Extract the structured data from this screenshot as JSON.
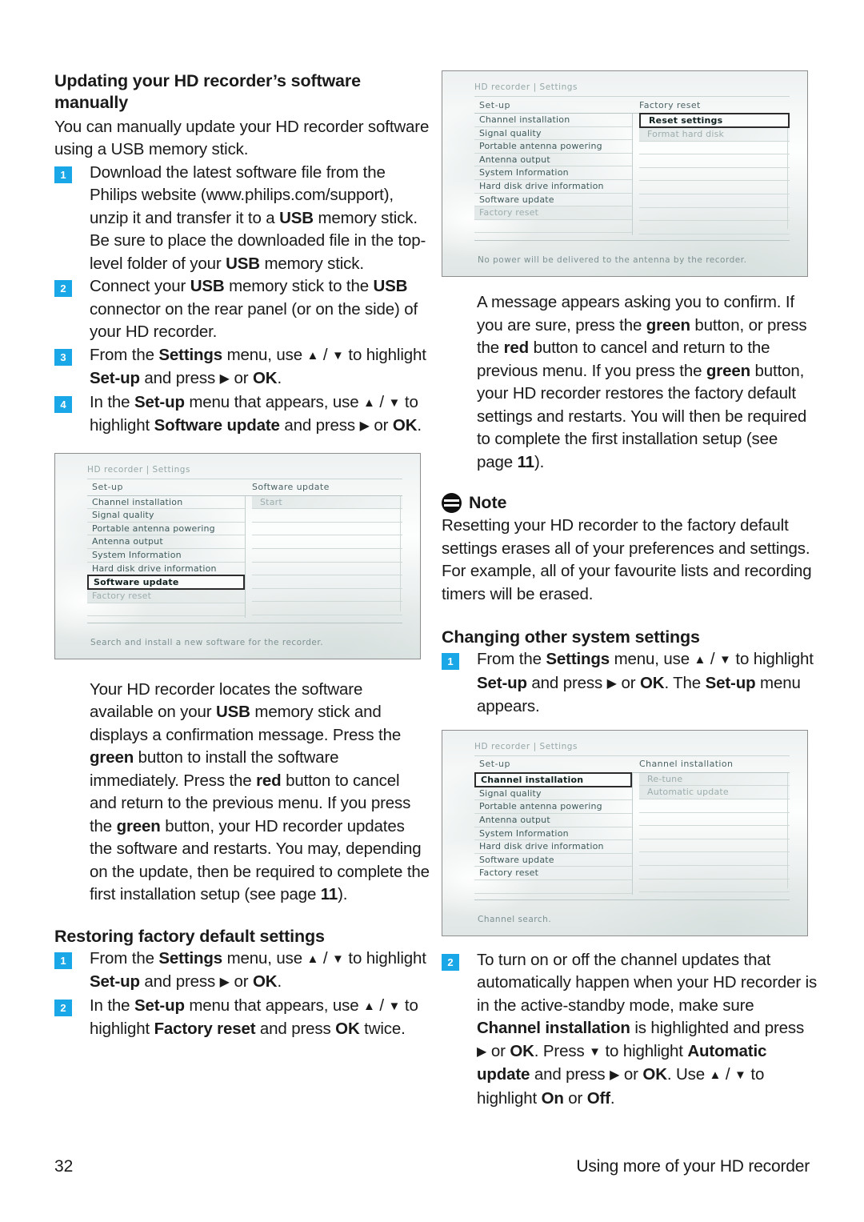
{
  "document": {
    "page_number": "32",
    "footer_title": "Using more of your HD recorder"
  },
  "left_column": {
    "heading": "Updating your HD recorder’s software manually",
    "intro": "You can manually update your HD recorder software using a USB memory stick.",
    "steps": [
      {
        "num": "1",
        "text": "Download the latest software file from the Philips website (www.philips.com/support), unzip it and transfer it to a USB memory stick. Be sure to place the downloaded file in the top-level folder of your USB memory stick."
      },
      {
        "num": "2",
        "text": "Connect your USB memory stick to the USB connector on the rear panel (or on the side) of your HD recorder."
      },
      {
        "num": "3",
        "text": "From the Settings menu, use ▲ / ▼ to highlight Set-up and press ▶ or OK."
      },
      {
        "num": "4",
        "text": "In the Set-up menu that appears, use ▲ / ▼ to highlight Software update and press ▶ or OK."
      }
    ],
    "after_image_paragraph": "Your HD recorder locates the software available on your USB memory stick and displays a confirmation message. Press the green button to install the software immediately. Press the red button to cancel and return to the previous menu. If you press the green button, your HD recorder updates the software and restarts. You may, depending on the update, then be required to complete the first installation setup (see page 11).",
    "restore_heading": "Restoring factory default settings",
    "restore_steps": [
      {
        "num": "1",
        "text": "From the Settings menu, use ▲ / ▼ to highlight Set-up and press ▶ or OK."
      },
      {
        "num": "2",
        "text": "In the Set-up menu that appears, use ▲ / ▼ to highlight Factory reset and press OK twice."
      }
    ]
  },
  "right_column": {
    "confirm_paragraph": "A message appears asking you to confirm. If you are sure, press the green button, or press the red button to cancel and return to the previous menu. If you press the green button, your HD recorder restores the factory default settings and restarts. You will then be required to complete the first installation setup (see page 11).",
    "note": {
      "icon": "note-icon",
      "title": "Note",
      "text": "Resetting your HD recorder to the factory default settings erases all of your preferences and settings. For example, all of your favourite lists and recording timers will be erased."
    },
    "changing_heading": "Changing other system settings",
    "changing_steps": [
      {
        "num": "1",
        "text": "From the Settings menu, use ▲ / ▼ to highlight Set-up and press ▶ or OK. The Set-up menu appears."
      },
      {
        "num": "2",
        "text": "To turn on or off the channel updates that automatically happen when your HD recorder is in the active-standby mode, make sure Channel installation is highlighted and press ▶ or OK. Press ▼ to highlight Automatic update and press ▶ or OK. Use ▲ / ▼ to highlight On or Off."
      }
    ]
  },
  "osd_screens": {
    "factory_reset": {
      "breadcrumb": "HD recorder | Settings",
      "col1_header": "Set-up",
      "col2_header": "Factory reset",
      "left_items": [
        "Channel installation",
        "Signal quality",
        "Portable antenna powering",
        "Antenna output",
        "System Information",
        "Hard disk drive information",
        "Software update",
        "Factory reset"
      ],
      "left_selected_index": 7,
      "left_selected_style": "dim",
      "right_items": [
        "Reset settings",
        "Format hard disk"
      ],
      "right_selected_index": 0,
      "status": "No power will be delivered to the antenna by the recorder."
    },
    "software_update": {
      "breadcrumb": "HD recorder | Settings",
      "col1_header": "Set-up",
      "col2_header": "Software update",
      "left_items": [
        "Channel installation",
        "Signal quality",
        "Portable antenna powering",
        "Antenna output",
        "System Information",
        "Hard disk drive information",
        "Software update",
        "Factory reset"
      ],
      "left_selected_index": 6,
      "left_selected_style": "box",
      "right_items": [
        "Start"
      ],
      "right_selected_index": -1,
      "status": "Search and install a new software for the recorder."
    },
    "channel_installation": {
      "breadcrumb": "HD recorder | Settings",
      "col1_header": "Set-up",
      "col2_header": "Channel installation",
      "left_items": [
        "Channel installation",
        "Signal quality",
        "Portable antenna powering",
        "Antenna output",
        "System Information",
        "Hard disk drive information",
        "Software update",
        "Factory reset"
      ],
      "left_selected_index": 0,
      "left_selected_style": "box",
      "right_items": [
        "Re-tune",
        "Automatic update"
      ],
      "right_selected_index": -1,
      "status": "Channel search."
    }
  },
  "colors": {
    "step_badge": "#1aa7e8",
    "text": "#1a1a1a",
    "osd_text": "#3f5a5b",
    "osd_dim": "#9dadad"
  }
}
